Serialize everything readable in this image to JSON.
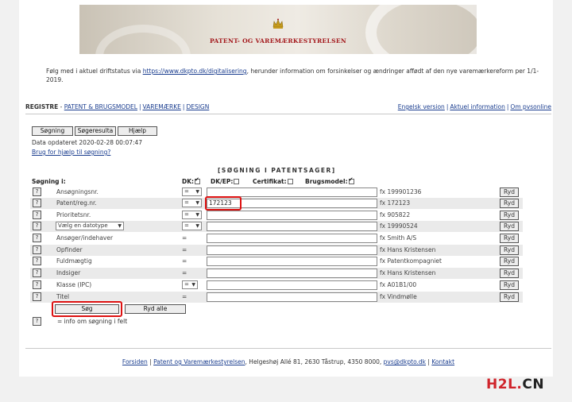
{
  "banner": {
    "org_name": "PATENT- OG VAREMÆRKESTYRELSEN"
  },
  "notice": {
    "prefix": "Følg med i aktuel driftstatus via ",
    "link": "https://www.dkpto.dk/digitalisering",
    "suffix": ", herunder information om forsinkelser og ændringer affødt af den nye varemærkereform per 1/1-2019."
  },
  "nav": {
    "registre": "REGISTRE",
    "dash": "-",
    "left_links": [
      "PATENT & BRUGSMODEL",
      "VAREMÆRKE",
      "DESIGN"
    ],
    "right_links": [
      "Engelsk version",
      "Aktuel information",
      "Om pvsonline"
    ]
  },
  "toolbar": {
    "search": "Søgning",
    "results": "Søgeresulta",
    "help": "Hjælp"
  },
  "updated": "Data opdateret 2020-02-28 00:07:47",
  "help_link": "Brug for hjælp til søgning?",
  "form": {
    "title": "[SØGNING I PATENTSAGER]",
    "search_in": "Søgning i:",
    "dk": "DK:",
    "dk_ep": "DK/EP:",
    "certifikat": "Certifikat:",
    "brugsmodel": "Brugsmodel:",
    "rows": [
      {
        "q": "?",
        "label": "Ansøgningsnr.",
        "op": "=",
        "value": "",
        "example": "fx 199901236",
        "clear": "Ryd"
      },
      {
        "q": "?",
        "label": "Patent/reg.nr.",
        "op": "=",
        "value": "172123",
        "example": "fx 172123",
        "clear": "Ryd"
      },
      {
        "q": "?",
        "label": "Prioritetsnr.",
        "op": "=",
        "value": "",
        "example": "fx 905822",
        "clear": "Ryd"
      },
      {
        "q": "?",
        "label": "Vælg en datotype",
        "op": "=",
        "value": "",
        "example": "fx 19990524",
        "clear": "Ryd"
      },
      {
        "q": "?",
        "label": "Ansøger/indehaver",
        "op": "=",
        "value": "",
        "example": "fx Smith A/S",
        "clear": "Ryd"
      },
      {
        "q": "?",
        "label": "Opfinder",
        "op": "=",
        "value": "",
        "example": "fx Hans Kristensen",
        "clear": "Ryd"
      },
      {
        "q": "?",
        "label": "Fuldmægtig",
        "op": "=",
        "value": "",
        "example": "fx Patentkompagniet",
        "clear": "Ryd"
      },
      {
        "q": "?",
        "label": "Indsiger",
        "op": "=",
        "value": "",
        "example": "fx Hans Kristensen",
        "clear": "Ryd"
      },
      {
        "q": "?",
        "label": "Klasse (IPC)",
        "op": "=",
        "value": "",
        "example": "fx A01B1/00",
        "clear": "Ryd"
      },
      {
        "q": "?",
        "label": "Titel",
        "op": "=",
        "value": "",
        "example": "fx Vindmølle",
        "clear": "Ryd"
      }
    ],
    "search_btn": "Søg",
    "clear_all": "Ryd alle",
    "info_q": "?",
    "info_text": "= info om søgning i felt"
  },
  "footer": {
    "link1": "Forsiden",
    "link2": "Patent og Varemærkestyrelsen",
    "address": ", Helgeshøj Allé 81, 2630 Tåstrup, 4350 8000,",
    "email": "pvs@dkpto.dk",
    "contact": "Kontakt"
  },
  "watermark": {
    "h": "H",
    "two": "2",
    "l": "L",
    "dot": ".",
    "cn": "CN"
  }
}
